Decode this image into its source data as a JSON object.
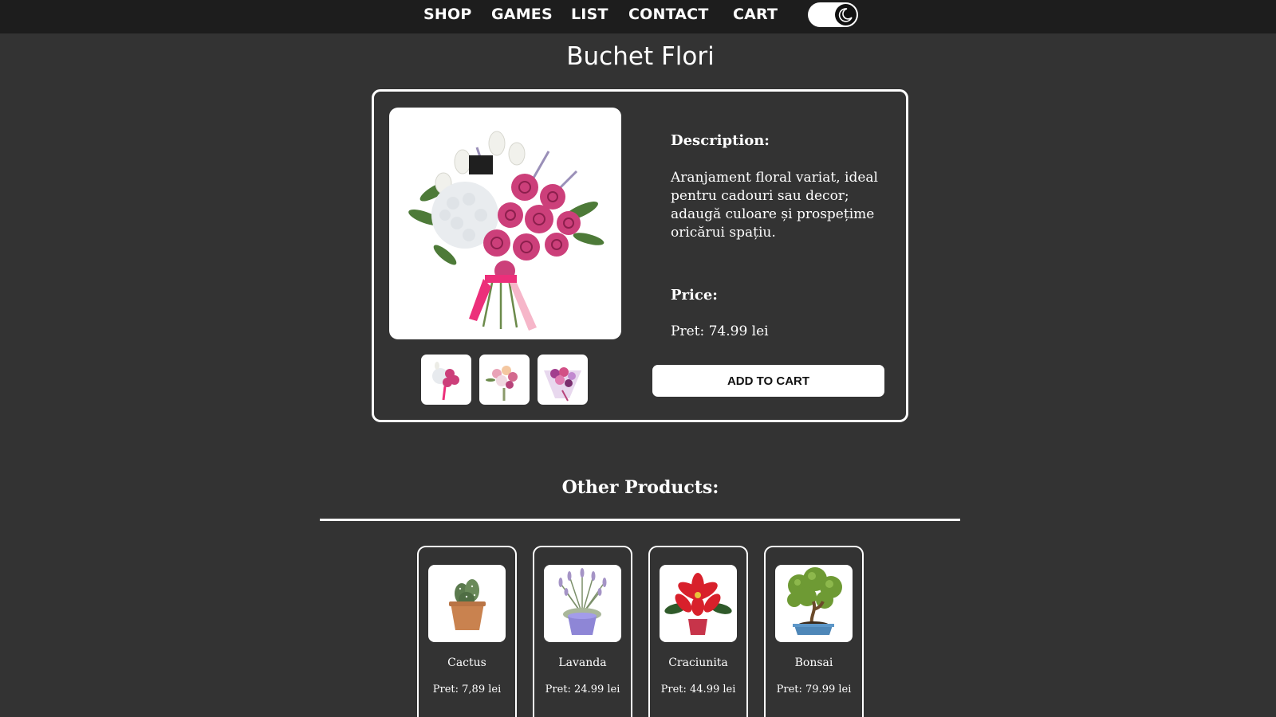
{
  "nav": {
    "links": [
      "SHOP",
      "GAMES",
      "LIST",
      "CONTACT",
      "CART"
    ],
    "theme_toggle_icon": "moon-icon"
  },
  "product": {
    "title": "Buchet Flori",
    "description_heading": "Description:",
    "description": "Aranjament floral variat, ideal pentru cadouri sau decor; adaugă culoare și prospețime oricărui spațiu.",
    "price_heading": "Price:",
    "price": "Pret: 74.99 lei",
    "add_to_cart_label": "ADD TO CART"
  },
  "other_products": {
    "title": "Other Products:",
    "items": [
      {
        "name": "Cactus",
        "price": "Pret: 7,89 lei"
      },
      {
        "name": "Lavanda",
        "price": "Pret: 24.99 lei"
      },
      {
        "name": "Craciunita",
        "price": "Pret: 44.99 lei"
      },
      {
        "name": "Bonsai",
        "price": "Pret: 79.99 lei"
      }
    ]
  },
  "colors": {
    "page_background": "#333333",
    "navbar_background": "#1d1d1d",
    "accent": "#ffffff"
  }
}
